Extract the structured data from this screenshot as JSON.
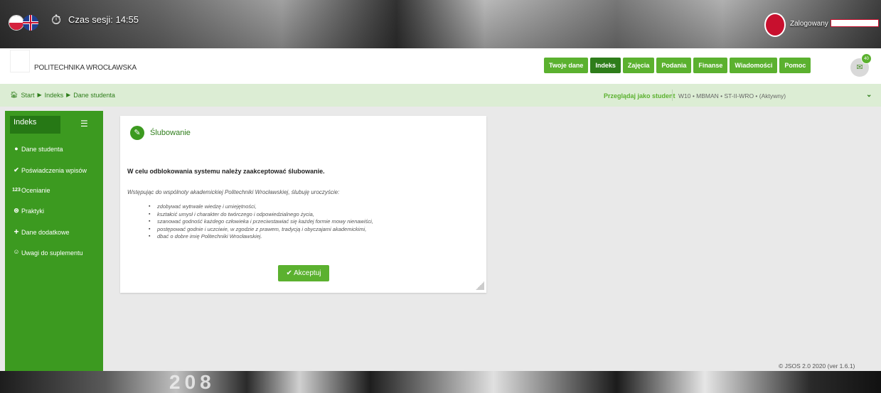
{
  "topbar": {
    "session_label": "Czas sesji: 14:55",
    "logged_label": "Zalogowany"
  },
  "header": {
    "brand": "POLITECHNIKA WROCŁAWSKA",
    "nav": [
      {
        "label": "Twoje dane",
        "active": false
      },
      {
        "label": "Indeks",
        "active": true
      },
      {
        "label": "Zajęcia",
        "active": false
      },
      {
        "label": "Podania",
        "active": false
      },
      {
        "label": "Finanse",
        "active": false
      },
      {
        "label": "Wiadomości",
        "active": false
      },
      {
        "label": "Pomoc",
        "active": false
      }
    ],
    "messages_count": "40"
  },
  "breadcrumb": {
    "items": [
      "Start",
      "Indeks",
      "Dane studenta"
    ],
    "browse_label": "Przeglądaj jako student",
    "browse_value": "W10 • MBMAN • ST-II-WRO • (Aktywny)"
  },
  "sidebar": {
    "title": "Indeks",
    "items": [
      {
        "icon": "person-icon",
        "glyph": "👤",
        "label": "Dane studenta"
      },
      {
        "icon": "check-icon",
        "glyph": "✔",
        "label": "Poświadczenia wpisów"
      },
      {
        "icon": "numbers-icon",
        "glyph": "123",
        "label": "Ocenianie"
      },
      {
        "icon": "briefcase-icon",
        "glyph": "⊜",
        "label": "Praktyki"
      },
      {
        "icon": "plus-icon",
        "glyph": "+",
        "label": "Dane dodatkowe"
      },
      {
        "icon": "comment-icon",
        "glyph": "☺",
        "label": "Uwagi do suplementu"
      }
    ]
  },
  "card": {
    "title": "Ślubowanie",
    "bold_text": "W celu odblokowania systemu należy zaakceptować ślubowanie.",
    "intro": "Wstępując do wspólnoty akademickiej Politechniki Wrocławskiej, ślubuję uroczyście:",
    "vows": [
      "zdobywać wytrwale wiedzę i umiejętności,",
      "kształcić umysł i charakter do twórczego i odpowiedzialnego życia,",
      "szanować godność każdego człowieka i przeciwstawiać się każdej formie mowy nienawiści,",
      "postępować godnie i uczciwie, w zgodzie z prawem, tradycją i obyczajami akademickimi,",
      "dbać o dobre imię Politechniki Wrocławskiej."
    ],
    "accept_label": "Akceptuj"
  },
  "footer": {
    "version": "© JSOS 2.0 2020 (ver 1.6.1)"
  },
  "background": {
    "bottom_text": "208"
  },
  "colors": {
    "accent_green": "#5bb12f",
    "dark_green": "#2e7d1a",
    "sidebar_green": "#3c9a20",
    "breadcrumb_bg": "#dcedd4"
  }
}
